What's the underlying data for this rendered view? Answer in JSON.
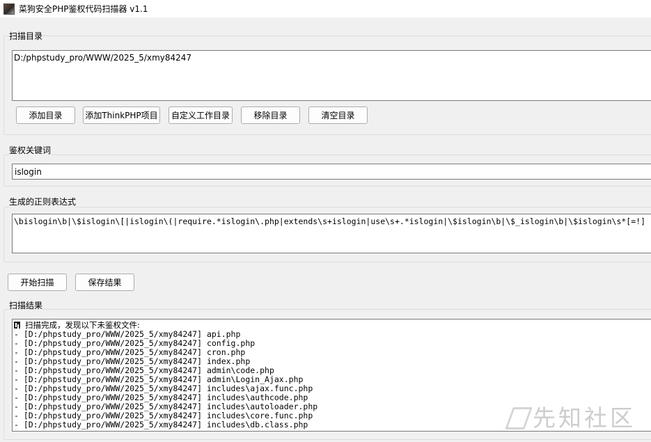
{
  "window": {
    "title": "菜狗安全PHP鉴权代码扫描器 v1.1"
  },
  "scan_dir": {
    "label": "扫描目录",
    "value": "D:/phpstudy_pro/WWW/2025_5/xmy84247",
    "buttons": {
      "add_dir": "添加目录",
      "add_thinkphp": "添加ThinkPHP项目",
      "custom_dir": "自定义工作目录",
      "remove_dir": "移除目录",
      "clear_dir": "清空目录"
    }
  },
  "keyword": {
    "label": "鉴权关键词",
    "value": "islogin"
  },
  "regex": {
    "label": "生成的正则表达式",
    "value": "\\bislogin\\b|\\$islogin\\[|islogin\\(|require.*islogin\\.php|extends\\s+islogin|use\\s+.*islogin|\\$islogin\\b|\\$_islogin\\b|\\$islogin\\s*[=!]"
  },
  "actions": {
    "start_scan": "开始扫描",
    "save_results": "保存结果"
  },
  "results": {
    "label": "扫描结果",
    "header": "扫描完成，发现以下未鉴权文件:",
    "items": [
      "- [D:/phpstudy_pro/WWW/2025_5/xmy84247] api.php",
      "- [D:/phpstudy_pro/WWW/2025_5/xmy84247] config.php",
      "- [D:/phpstudy_pro/WWW/2025_5/xmy84247] cron.php",
      "- [D:/phpstudy_pro/WWW/2025_5/xmy84247] index.php",
      "- [D:/phpstudy_pro/WWW/2025_5/xmy84247] admin\\code.php",
      "- [D:/phpstudy_pro/WWW/2025_5/xmy84247] admin\\Login_Ajax.php",
      "- [D:/phpstudy_pro/WWW/2025_5/xmy84247] includes\\ajax.func.php",
      "- [D:/phpstudy_pro/WWW/2025_5/xmy84247] includes\\authcode.php",
      "- [D:/phpstudy_pro/WWW/2025_5/xmy84247] includes\\autoloader.php",
      "- [D:/phpstudy_pro/WWW/2025_5/xmy84247] includes\\core.func.php",
      "- [D:/phpstudy_pro/WWW/2025_5/xmy84247] includes\\db.class.php"
    ]
  },
  "watermark": {
    "text": "先知社区"
  }
}
